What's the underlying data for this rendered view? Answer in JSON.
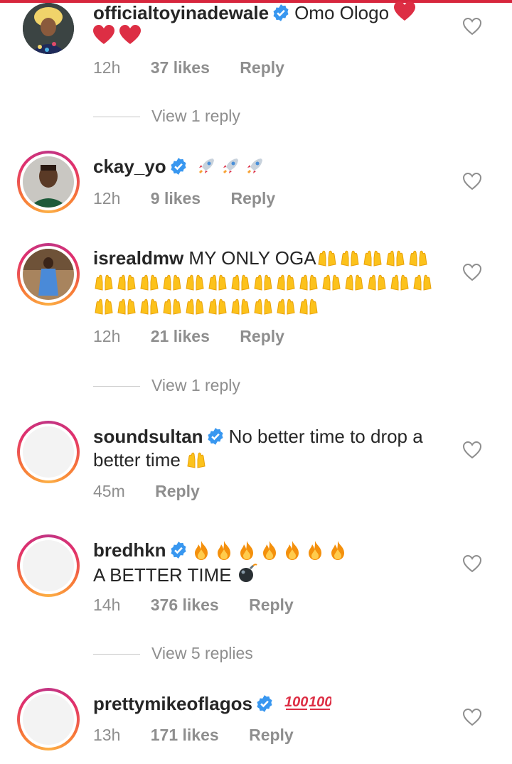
{
  "colors": {
    "verified": "#3897f0",
    "meta": "#8e8e8e",
    "text": "#262626",
    "topbar": "#d7263d"
  },
  "comments": [
    {
      "user": "officialtoyinadewale",
      "verified": true,
      "text": "Omo Ologo",
      "emoji": "heart-emoji x3",
      "time": "12h",
      "likes": "37 likes",
      "reply": "Reply",
      "view_replies": "View 1 reply"
    },
    {
      "user": "ckay_yo",
      "verified": true,
      "text": "",
      "emoji": "rocket-emoji x3",
      "time": "12h",
      "likes": "9 likes",
      "reply": "Reply"
    },
    {
      "user": "isrealdmw",
      "verified": false,
      "text": "MY ONLY OGA",
      "emoji": "raising-hands-emoji x30",
      "time": "12h",
      "likes": "21 likes",
      "reply": "Reply",
      "view_replies": "View 1 reply"
    },
    {
      "user": "soundsultan",
      "verified": true,
      "text": "No better time to drop a better time",
      "emoji": "raising-hands-emoji",
      "time": "45m",
      "likes": "",
      "reply": "Reply"
    },
    {
      "user": "bredhkn",
      "verified": true,
      "text": "A BETTER TIME",
      "emoji": "fire-emoji x7, bomb-emoji",
      "time": "14h",
      "likes": "376 likes",
      "reply": "Reply",
      "view_replies": "View 5 replies"
    },
    {
      "user": "prettymikeoflagos",
      "verified": true,
      "text": "",
      "emoji": "hundred-points-emoji x2",
      "time": "13h",
      "likes": "171 likes",
      "reply": "Reply"
    }
  ]
}
